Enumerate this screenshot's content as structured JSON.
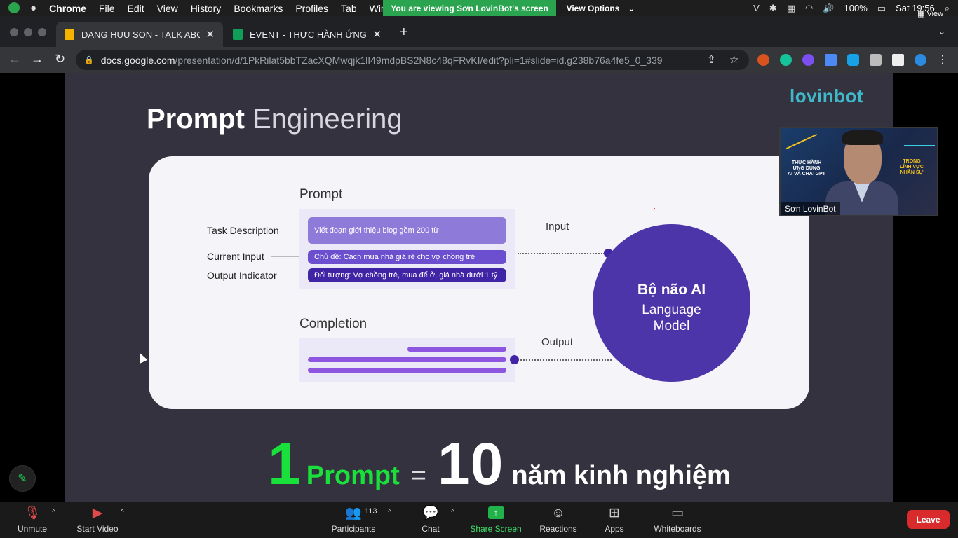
{
  "menubar": {
    "app_name": "Chrome",
    "items": [
      "File",
      "Edit",
      "View",
      "History",
      "Bookmarks",
      "Profiles",
      "Tab",
      "Wir"
    ],
    "zoom_banner": "You are viewing Sơn LovinBot's screen",
    "view_options": "View Options",
    "battery": "100%",
    "clock": "Sat 19:56"
  },
  "browser": {
    "tabs": [
      {
        "title": "DANG HUU SON - TALK ABOU",
        "favicon_color": "#f4b400",
        "active": true
      },
      {
        "title": "EVENT - THỰC HÀNH ỨNG DỤ",
        "favicon_color": "#0f9d58",
        "active": false
      }
    ],
    "new_tab": "+",
    "url_host": "docs.google.com",
    "url_path": "/presentation/d/1PkRilat5bbTZacXQMwqjk1lI49mdpBS2N8c48qFRvKI/edit?pli=1#slide=id.g238b76a4fe5_0_339",
    "extensions": [
      "tampermonkey-icon",
      "grammarly-icon",
      "puzzle-ext-icon",
      "docs-ext-icon",
      "translate-ext-icon",
      "extensions-icon",
      "sidepanel-icon",
      "bing-icon"
    ]
  },
  "slide": {
    "title_bold": "Prompt",
    "title_light": "Engineering",
    "brand": "lovinbot",
    "prompt_heading": "Prompt",
    "labels": {
      "task": "Task Description",
      "current": "Current Input",
      "output_indicator": "Output Indicator"
    },
    "pills": {
      "task": "Viết đoạn giới thiệu blog gồm 200 từ",
      "current": "Chủ đề: Cách mua nhà giá rẻ cho vợ chồng trẻ",
      "output": "Đối tượng: Vợ chồng trẻ, mua để ở, giá nhà dưới 1 tỷ"
    },
    "input_label": "Input",
    "completion_heading": "Completion",
    "output_label": "Output",
    "brain_title": "Bộ não AI",
    "brain_sub": "Language\nModel",
    "bottom": {
      "one": "1",
      "prompt": "Prompt",
      "equals": "=",
      "ten": "10",
      "rest": "năm kinh nghiệm"
    }
  },
  "video": {
    "name": "Sơn LovinBot",
    "left_text": "THỰC HÀNH\nỨNG DỤNG\nAI VÀ CHATGPT",
    "right_text": "TRONG\nLĨNH VỰC\nNHÂN SỰ",
    "view_label": "View"
  },
  "zoom_bar": {
    "unmute": "Unmute",
    "start_video": "Start Video",
    "participants": "Participants",
    "participants_count": "113",
    "chat": "Chat",
    "share_screen": "Share Screen",
    "reactions": "Reactions",
    "apps": "Apps",
    "whiteboards": "Whiteboards",
    "leave": "Leave"
  }
}
